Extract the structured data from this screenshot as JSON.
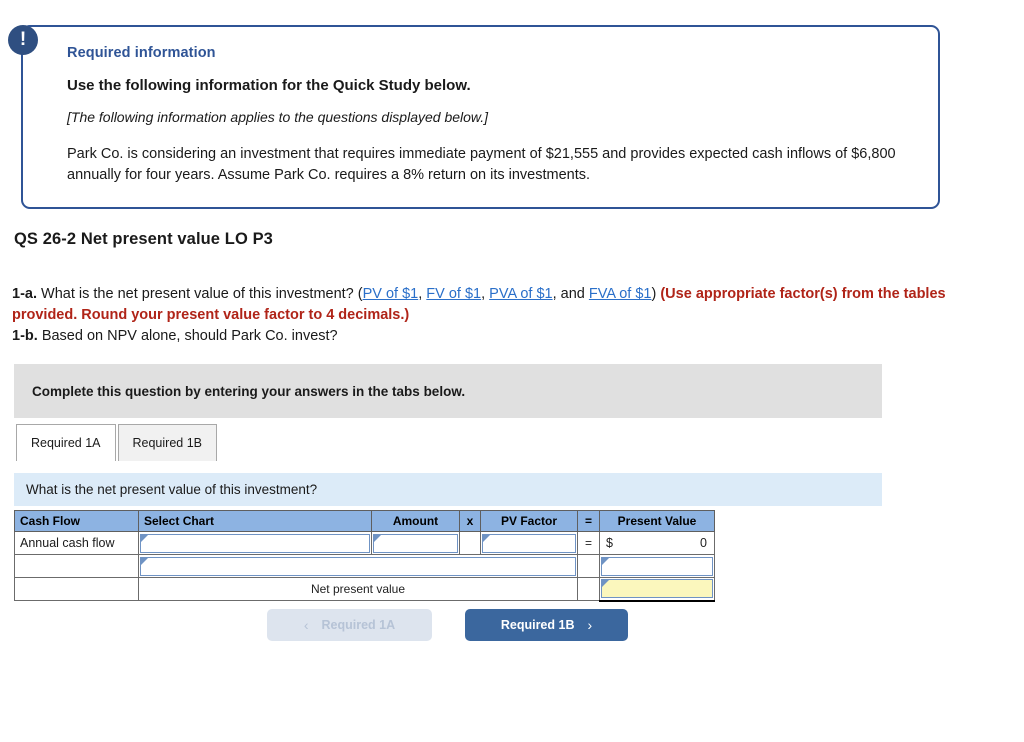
{
  "callout": {
    "icon": "exclamation-icon",
    "icon_glyph": "!",
    "required_info_label": "Required information",
    "quick_study_heading": "Use the following information for the Quick Study below.",
    "applies_note": "[The following information applies to the questions displayed below.]",
    "scenario": "Park Co. is considering an investment that requires immediate payment of $21,555 and provides expected cash inflows of $6,800 annually for four years. Assume Park Co. requires a 8% return on its investments.",
    "border_color": "#2f5496",
    "icon_color": "#2f4f81"
  },
  "question": {
    "title": "QS 26-2 Net present value LO P3",
    "part_a_label": "1-a.",
    "part_a_text": "What is the net present value of this investment? (",
    "links": [
      {
        "label": "PV of $1",
        "sep": ", "
      },
      {
        "label": "FV of $1",
        "sep": ", "
      },
      {
        "label": "PVA of $1",
        "sep": ", and "
      },
      {
        "label": "FVA of $1",
        "sep": ")"
      }
    ],
    "instruction_red": " (Use appropriate factor(s) from the tables provided. Round your present value factor to 4 decimals.)",
    "part_b_label": "1-b.",
    "part_b_text": "Based on NPV alone, should Park Co. invest?",
    "link_color": "#2a6fc9",
    "instruction_color": "#b02418"
  },
  "banner": {
    "text": "Complete this question by entering your answers in the tabs below.",
    "background": "#e0e0e0"
  },
  "tabs": [
    {
      "label": "Required 1A",
      "active": true
    },
    {
      "label": "Required 1B",
      "active": false
    }
  ],
  "prompt_strip": {
    "text": "What is the net present value of this investment?",
    "background": "#dcebf8"
  },
  "worksheet": {
    "header_background": "#8db3e2",
    "columns": [
      "Cash Flow",
      "Select Chart",
      "Amount",
      "x",
      "PV Factor",
      "=",
      "Present Value"
    ],
    "row1": {
      "cash_flow": "Annual cash flow",
      "select_chart": "",
      "amount": "",
      "times_operator": "",
      "pv_factor": "",
      "equals_operator": "=",
      "present_value_currency": "$",
      "present_value": "0"
    },
    "row2": {
      "cash_flow": "",
      "merged_input": "",
      "present_value": ""
    },
    "row3": {
      "cash_flow": "",
      "label": "Net present value",
      "answer": "",
      "answer_background": "#fbf7bd"
    }
  },
  "navigation": {
    "prev_label": "Required 1A",
    "prev_icon": "chevron-left-icon",
    "prev_glyph": "‹",
    "next_label": "Required 1B",
    "next_icon": "chevron-right-icon",
    "next_glyph": "›",
    "next_color": "#3b679e",
    "prev_color": "#dde4ee"
  }
}
